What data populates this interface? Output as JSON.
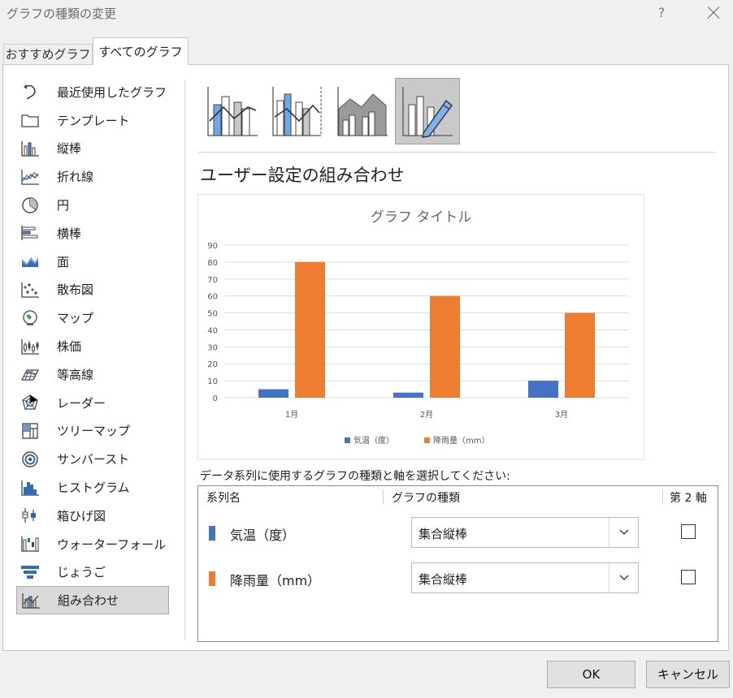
{
  "window": {
    "title": "グラフの種類の変更",
    "help": "?"
  },
  "tabs": [
    {
      "label": "おすすめグラフ",
      "active": false
    },
    {
      "label": "すべてのグラフ",
      "active": true
    }
  ],
  "sidebar": {
    "items": [
      {
        "label": "最近使用したグラフ",
        "icon": "recent-icon"
      },
      {
        "label": "テンプレート",
        "icon": "folder-icon"
      },
      {
        "label": "縦棒",
        "icon": "column-chart-icon"
      },
      {
        "label": "折れ線",
        "icon": "line-chart-icon"
      },
      {
        "label": "円",
        "icon": "pie-chart-icon"
      },
      {
        "label": "横棒",
        "icon": "bar-chart-icon"
      },
      {
        "label": "面",
        "icon": "area-chart-icon"
      },
      {
        "label": "散布図",
        "icon": "scatter-chart-icon"
      },
      {
        "label": "マップ",
        "icon": "map-chart-icon"
      },
      {
        "label": "株価",
        "icon": "stock-chart-icon"
      },
      {
        "label": "等高線",
        "icon": "surface-chart-icon"
      },
      {
        "label": "レーダー",
        "icon": "radar-chart-icon"
      },
      {
        "label": "ツリーマップ",
        "icon": "treemap-chart-icon"
      },
      {
        "label": "サンバースト",
        "icon": "sunburst-chart-icon"
      },
      {
        "label": "ヒストグラム",
        "icon": "histogram-chart-icon"
      },
      {
        "label": "箱ひげ図",
        "icon": "box-whisker-chart-icon"
      },
      {
        "label": "ウォーターフォール",
        "icon": "waterfall-chart-icon"
      },
      {
        "label": "じょうご",
        "icon": "funnel-chart-icon"
      },
      {
        "label": "組み合わせ",
        "icon": "combo-chart-icon",
        "selected": true
      }
    ]
  },
  "combo": {
    "title": "ユーザー設定の組み合わせ",
    "variants": [
      {
        "icon": "clustered-column-line-icon",
        "selected": false
      },
      {
        "icon": "clustered-column-line-secondary-axis-icon",
        "selected": false
      },
      {
        "icon": "stacked-area-clustered-column-icon",
        "selected": false
      },
      {
        "icon": "custom-combination-icon",
        "selected": true
      }
    ]
  },
  "colors": {
    "blue": "#4472c4",
    "orange": "#ed7d31",
    "selected_bg": "#c9c9c9"
  },
  "chart_data": {
    "type": "bar",
    "title": "グラフ タイトル",
    "categories": [
      "1月",
      "2月",
      "3月"
    ],
    "series": [
      {
        "name": "気温（度）",
        "values": [
          5,
          3,
          10
        ],
        "color": "#4472c4"
      },
      {
        "name": "降雨量（mm）",
        "values": [
          80,
          60,
          50
        ],
        "color": "#ed7d31"
      }
    ],
    "ylim": [
      0,
      90
    ],
    "yticks": [
      "0",
      "10",
      "20",
      "30",
      "40",
      "50",
      "60",
      "70",
      "80",
      "90"
    ],
    "grid": true,
    "legend": "bottom"
  },
  "series_section": {
    "label": "データ系列に使用するグラフの種類と軸を選択してください:",
    "headers": {
      "name": "系列名",
      "type": "グラフの種類",
      "axis": "第 2 軸"
    },
    "rows": [
      {
        "name": "気温（度）",
        "chart_type": "集合縦棒",
        "secondary": false,
        "color": "#4472c4"
      },
      {
        "name": "降雨量（mm）",
        "chart_type": "集合縦棒",
        "secondary": false,
        "color": "#ed7d31"
      }
    ]
  },
  "buttons": {
    "ok": "OK",
    "cancel": "キャンセル"
  }
}
